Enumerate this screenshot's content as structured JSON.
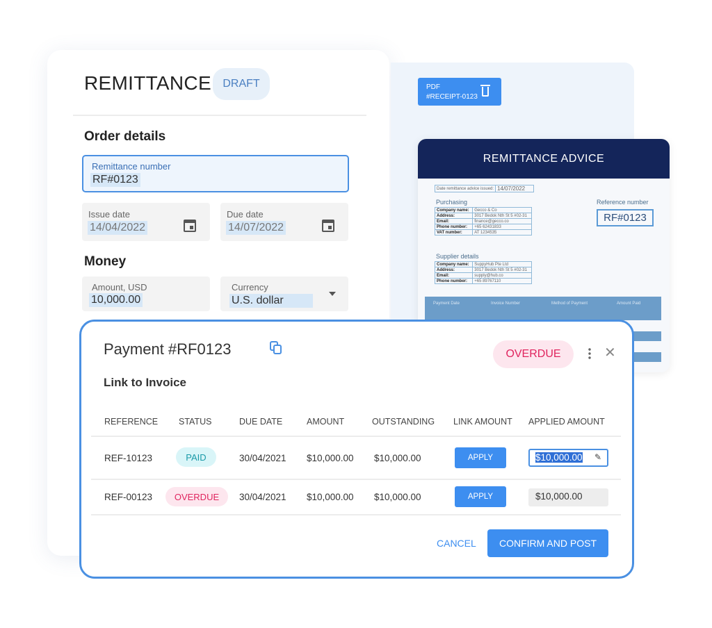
{
  "remittance": {
    "title": "REMITTANCE",
    "status": "DRAFT",
    "order_details": "Order details",
    "remittance_number": {
      "label": "Remittance number",
      "value": "RF#0123"
    },
    "issue_date": {
      "label": "Issue date",
      "value": "14/04/2022"
    },
    "due_date": {
      "label": "Due date",
      "value": "14/07/2022"
    },
    "money": "Money",
    "amount": {
      "label": "Amount, USD",
      "value": "10,000.00"
    },
    "currency": {
      "label": "Currency",
      "value": "U.S. dollar"
    }
  },
  "attachment": {
    "type": "PDF",
    "name": "#RECEIPT-0123"
  },
  "document": {
    "title": "REMITTANCE ADVICE",
    "date_label": "Date remittance advice issued:",
    "date": "14/07/2022",
    "purchasing": "Purchasing",
    "purchasing_rows": [
      [
        "Company name:",
        "Gecco & Co"
      ],
      [
        "Address:",
        "3017 Bedok Nth St 5 #02-31"
      ],
      [
        "Email:",
        "finance@gecco.co"
      ],
      [
        "Phone number:",
        "+65 62431833"
      ],
      [
        "VAT number:",
        "AT 1234535"
      ]
    ],
    "supplier": "Supplier details",
    "supplier_rows": [
      [
        "Company name:",
        "SuppyHub Pte Ltd"
      ],
      [
        "Address:",
        "3017 Bedok Nth St 5 #02-31"
      ],
      [
        "Email:",
        "supply@hub.co"
      ],
      [
        "Phone number:",
        "+65 89767110"
      ]
    ],
    "reference_label": "Reference number",
    "reference": "RF#0123",
    "table_headers": [
      "Payment Date",
      "Invoice Number",
      "Method of Payment",
      "Amount Paid"
    ]
  },
  "payment": {
    "title": "Payment #RF0123",
    "status": "OVERDUE",
    "section": "Link to Invoice",
    "headers": [
      "REFERENCE",
      "STATUS",
      "DUE DATE",
      "AMOUNT",
      "OUTSTANDING",
      "LINK AMOUNT",
      "APPLIED AMOUNT"
    ],
    "rows": [
      {
        "reference": "REF-10123",
        "status": "PAID",
        "due_date": "30/04/2021",
        "amount": "$10,000.00",
        "outstanding": "$10,000.00",
        "link": "APPLY",
        "applied": "$10,000.00"
      },
      {
        "reference": "REF-00123",
        "status": "OVERDUE",
        "due_date": "30/04/2021",
        "amount": "$10,000.00",
        "outstanding": "$10,000.00",
        "link": "APPLY",
        "applied": "$10,000.00"
      }
    ],
    "cancel": "CANCEL",
    "confirm": "CONFIRM AND POST"
  },
  "colors": {
    "accent": "#3d8ef0",
    "navy": "#14255a",
    "overdue": "#e0245e",
    "paid": "#1a9aa8"
  }
}
